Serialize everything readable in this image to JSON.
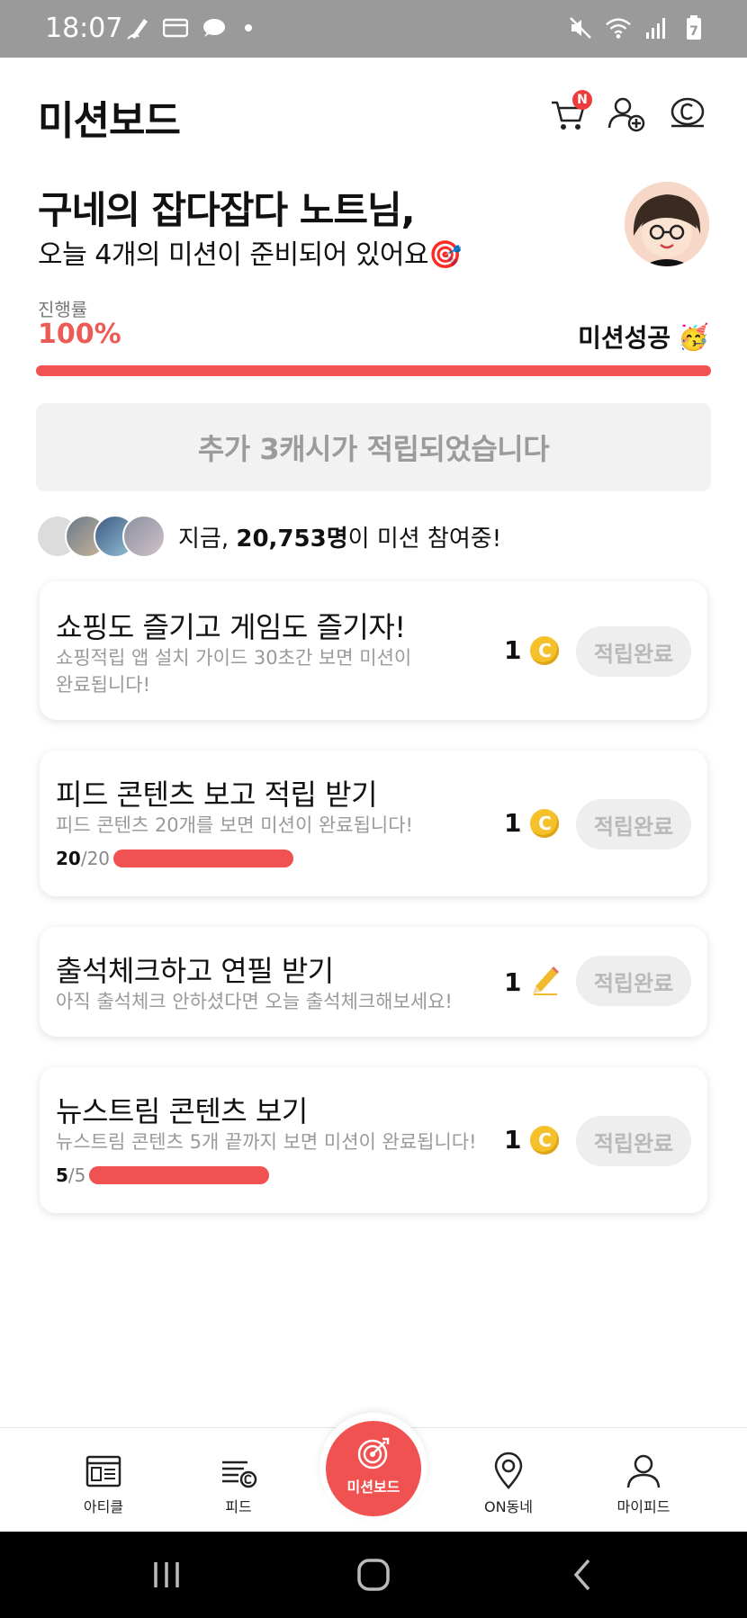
{
  "status_bar": {
    "time": "18:07",
    "left_icons": [
      "pen-icon",
      "wallet-icon",
      "chat-bubble-icon",
      "dot-icon"
    ],
    "right_icons": [
      "mute-icon",
      "wifi-icon",
      "signal-icon",
      "battery-icon"
    ],
    "battery_level": "7"
  },
  "header": {
    "title": "미션보드",
    "cart_badge": "N",
    "icons": [
      "cart-icon",
      "add-friend-icon",
      "cash-icon"
    ]
  },
  "greeting": {
    "name": "구네의 잡다잡다 노트님,",
    "subtitle": "오늘 4개의 미션이 준비되어 있어요",
    "subtitle_emoji": "🎯"
  },
  "progress": {
    "label": "진행률",
    "value_text": "100%",
    "value": 1.0,
    "status": "미션성공",
    "status_emoji": "🥳"
  },
  "notice": {
    "text": "추가 3캐시가 적립되었습니다"
  },
  "participants": {
    "prefix": "지금, ",
    "count": "20,753명",
    "suffix": "이 미션 참여중!"
  },
  "missions": [
    {
      "title": "쇼핑도 즐기고 게임도 즐기자!",
      "description": "쇼핑적립 앱 설치 가이드 30초간 보면 미션이 완료됩니다!",
      "reward": "1",
      "reward_icon": "coin-icon",
      "button": "적립완료"
    },
    {
      "title": "피드 콘텐츠 보고 적립 받기",
      "description": "피드 콘텐츠 20개를 보면 미션이 완료됩니다!",
      "progress_done": "20",
      "progress_total": "/20",
      "progress": 1.0,
      "reward": "1",
      "reward_icon": "coin-icon",
      "button": "적립완료"
    },
    {
      "title": "출석체크하고 연필 받기",
      "description": "아직 출석체크 안하셨다면 오늘 출석체크해보세요!",
      "reward": "1",
      "reward_icon": "pencil-icon",
      "button": "적립완료"
    },
    {
      "title": "뉴스트림 콘텐츠 보기",
      "description": "뉴스트림 콘텐츠 5개 끝까지 보면 미션이 완료됩니다!",
      "progress_done": "5",
      "progress_total": "/5",
      "progress": 1.0,
      "reward": "1",
      "reward_icon": "coin-icon",
      "button": "적립완료"
    }
  ],
  "bottom_nav": {
    "items": [
      {
        "label": "아티클",
        "icon": "article-icon"
      },
      {
        "label": "피드",
        "icon": "feed-icon"
      },
      {
        "label": "미션보드",
        "icon": "target-icon",
        "active": true
      },
      {
        "label": "ON동네",
        "icon": "location-pin-icon"
      },
      {
        "label": "마이피드",
        "icon": "person-icon"
      }
    ]
  },
  "colors": {
    "accent": "#ef5250",
    "accent_text": "#ec5b55",
    "status_bar": "#9a9a9a",
    "coin": "#f4c12a",
    "muted_text": "#9a9a9a"
  }
}
